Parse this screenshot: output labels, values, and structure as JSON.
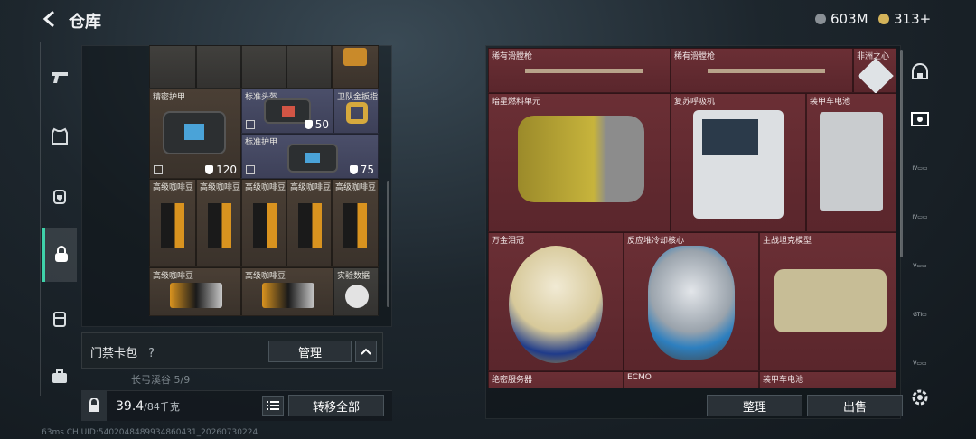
{
  "header": {
    "title": "仓库",
    "currency_a": "603M",
    "currency_b": "313+"
  },
  "left_grid": {
    "items": [
      {
        "name": "精密护甲",
        "value": "120"
      },
      {
        "name": "标准头盔",
        "value": "50"
      },
      {
        "name": "卫队金扳指",
        "value": ""
      },
      {
        "name": "标准护甲",
        "value": "75"
      },
      {
        "name": "高级咖啡豆"
      },
      {
        "name": "高级咖啡豆"
      },
      {
        "name": "高级咖啡豆"
      },
      {
        "name": "高级咖啡豆"
      },
      {
        "name": "高级咖啡豆"
      },
      {
        "name": "高级咖啡豆"
      },
      {
        "name": "高级咖啡豆"
      },
      {
        "name": "实验数据"
      }
    ]
  },
  "keybag": {
    "label": "门禁卡包",
    "help": "?",
    "manage_label": "管理",
    "sublabel": "长弓溪谷 5/9"
  },
  "capacity": {
    "value": "39.4",
    "max": "/84千克",
    "transfer_label": "转移全部"
  },
  "right_grid": {
    "items": [
      {
        "name": "稀有滑膛枪"
      },
      {
        "name": "稀有滑膛枪"
      },
      {
        "name": "非洲之心"
      },
      {
        "name": "暗星燃料单元"
      },
      {
        "name": "复苏呼吸机"
      },
      {
        "name": "装甲车电池"
      },
      {
        "name": "万金泪冠"
      },
      {
        "name": "反应堆冷却核心"
      },
      {
        "name": "主战坦克模型"
      },
      {
        "name": "绝密服务器"
      },
      {
        "name": "ECMO"
      },
      {
        "name": "装甲车电池"
      }
    ]
  },
  "actions": {
    "sort_label": "整理",
    "sell_label": "出售"
  },
  "footer": {
    "text": "63ms  CH UID:5402048489934860431_20260730224"
  },
  "icons": {
    "back": "back-arrow-icon",
    "rail": [
      "pistol-icon",
      "armor-icon",
      "backpack-shield-icon",
      "bag-icon",
      "vest-icon",
      "briefcase-icon"
    ],
    "right_rail": [
      "helmet-icon",
      "safe-icon",
      "storage-iv-icon",
      "storage-iv-b-icon",
      "storage-v-icon",
      "storage-gti-icon",
      "storage-vi-icon"
    ]
  },
  "colors": {
    "accent": "#3fd1a9",
    "rare_bg": "#6b2f35",
    "panel_bg": "#1d262d"
  }
}
